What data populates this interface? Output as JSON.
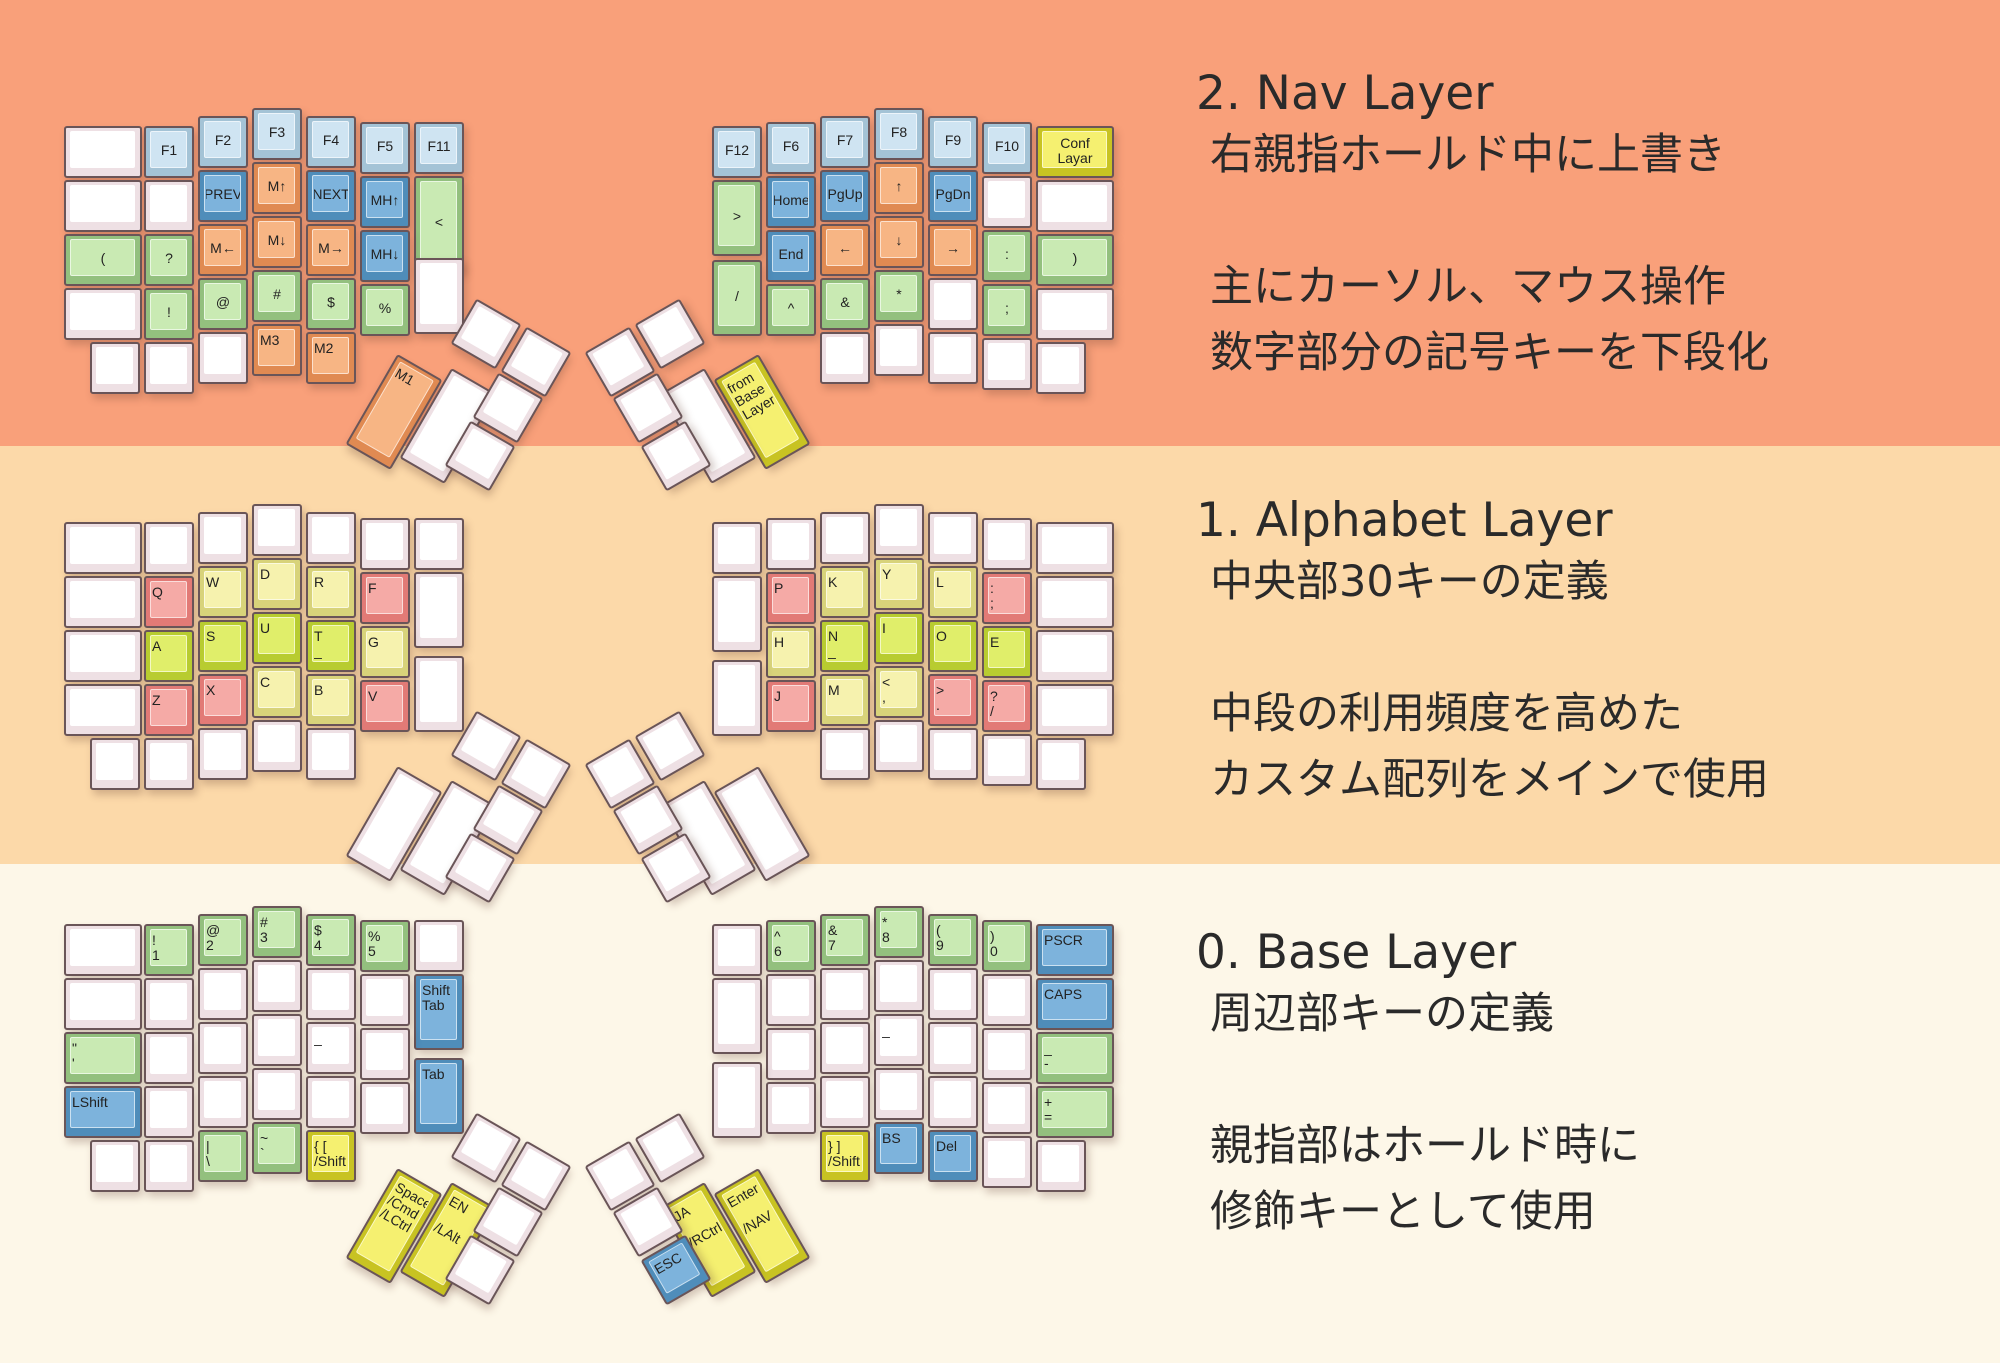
{
  "layers": {
    "nav": {
      "title": "2. Nav Layer",
      "lines": [
        "右親指ホールド中に上書き",
        "",
        "主にカーソル、マウス操作",
        "数字部分の記号キーを下段化"
      ]
    },
    "alpha": {
      "title": "1. Alphabet Layer",
      "lines": [
        "中央部30キーの定義",
        "",
        "中段の利用頻度を高めた",
        "カスタム配列をメインで使用"
      ]
    },
    "base": {
      "title": "0. Base Layer",
      "lines": [
        "周辺部キーの定義",
        "",
        "親指部はホールド時に",
        "修飾キーとして使用"
      ]
    }
  },
  "keyboards": {
    "nav": {
      "left": {
        "r0": [
          "",
          "F1",
          "F2",
          "F3",
          "F4",
          "F5",
          "F11"
        ],
        "r1": [
          "",
          "",
          "PREV",
          "M↑",
          "NEXT",
          "MH↑",
          "<"
        ],
        "r2": [
          "(",
          "?",
          "M←",
          "M↓",
          "M→",
          "MH↓",
          ""
        ],
        "r3": [
          "",
          "!",
          "@",
          "#",
          "$",
          "%",
          ""
        ],
        "r4": [
          "",
          "",
          "",
          "M3",
          "M2"
        ],
        "thumb": [
          "M1",
          "",
          "",
          "",
          "",
          ""
        ]
      },
      "right": {
        "r0": [
          "F12",
          "F6",
          "F7",
          "F8",
          "F9",
          "F10",
          "Conf\nLayar"
        ],
        "r1": [
          ">",
          "Home",
          "PgUp",
          "↑",
          "PgDn",
          "",
          ""
        ],
        "r2": [
          "",
          "End",
          "←",
          "↓",
          "→",
          ":",
          ")"
        ],
        "r3": [
          "/",
          "^",
          "&",
          "*",
          "",
          ";",
          ""
        ],
        "r4": [
          "",
          "",
          "",
          "",
          ""
        ],
        "thumb": [
          "from\nBase\nLayer",
          "",
          "",
          "",
          "",
          ""
        ]
      }
    },
    "alpha": {
      "left": {
        "r1": [
          "",
          "Q",
          "W",
          "D",
          "R",
          "F",
          ""
        ],
        "r2": [
          "",
          "A",
          "S",
          "U",
          "T\n_",
          "G",
          ""
        ],
        "r3": [
          "",
          "Z",
          "X",
          "C",
          "B",
          "V",
          ""
        ]
      },
      "right": {
        "r1": [
          "",
          "P",
          "K",
          "Y",
          "L",
          ":\n;",
          ""
        ],
        "r2": [
          "",
          "H",
          "N\n_",
          "I",
          "O",
          "E",
          ""
        ],
        "r3": [
          "",
          "J",
          "M",
          "<\n,",
          ">\n.",
          "?\n/",
          ""
        ]
      }
    },
    "base": {
      "left": {
        "r0": [
          "",
          "!\n1",
          "@\n2",
          "#\n3",
          "$\n4",
          "%\n5",
          ""
        ],
        "r1": [
          "",
          "",
          "",
          "",
          "",
          "",
          "Shift\nTab"
        ],
        "r2": [
          "\"\n'",
          "",
          "",
          "",
          "_",
          "",
          ""
        ],
        "r3": [
          "LShift",
          "",
          "",
          "",
          "",
          "",
          "Tab"
        ],
        "r4": [
          "",
          "",
          "|\n\\",
          "~\n`",
          "{  [\n/Shift"
        ],
        "thumb": [
          "Space\n/Cmd\n/LCtrl",
          "EN\n\n/LAlt"
        ]
      },
      "right": {
        "r0": [
          "",
          "^\n6",
          "&\n7",
          "*\n8",
          "(\n9",
          ")\n0",
          "PSCR"
        ],
        "r1": [
          "",
          "",
          "",
          "",
          "",
          "",
          "CAPS"
        ],
        "r2": [
          "",
          "",
          "",
          "_",
          "",
          "",
          "_\n-"
        ],
        "r3": [
          "",
          "",
          "",
          "",
          "",
          "",
          "+\n="
        ],
        "r4": [
          "}  ]\n/Shift",
          "BS",
          "Del",
          "",
          ""
        ],
        "thumb": [
          "ESC",
          "JA\n\n/RCtrl",
          "Enter\n\n/NAV"
        ]
      }
    }
  },
  "colors": {
    "nav_band": "#f9a07a",
    "alpha_band": "#fcd9a9",
    "base_band": "#fdf7e8"
  }
}
